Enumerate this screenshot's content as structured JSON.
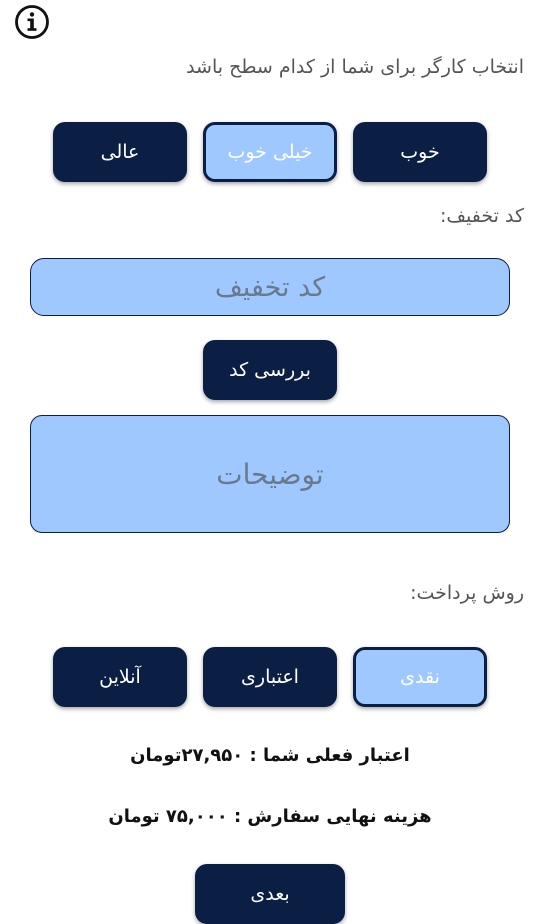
{
  "worker_level": {
    "prompt": "انتخاب کارگر برای شما از کدام سطح باشد",
    "options": [
      {
        "label": "خوب",
        "selected": false
      },
      {
        "label": "خیلی خوب",
        "selected": true
      },
      {
        "label": "عالی",
        "selected": false
      }
    ]
  },
  "discount": {
    "label": "کد تخفیف:",
    "placeholder": "کد تخفیف",
    "check_button": "بررسی کد"
  },
  "description": {
    "placeholder": "توضیحات"
  },
  "payment": {
    "label": "روش پرداخت:",
    "options": [
      {
        "label": "نقدی",
        "selected": true
      },
      {
        "label": "اعتباری",
        "selected": false
      },
      {
        "label": "آنلاین",
        "selected": false
      }
    ]
  },
  "summary": {
    "credit": "اعتبار فعلی شما : ۲۷,۹۵۰تومان",
    "total": "هزینه نهایی سفارش : ۷۵,۰۰۰ تومان"
  },
  "next_button": "بعدی",
  "colors": {
    "navy": "#0b1f45",
    "light_blue": "#9ec8ff"
  }
}
